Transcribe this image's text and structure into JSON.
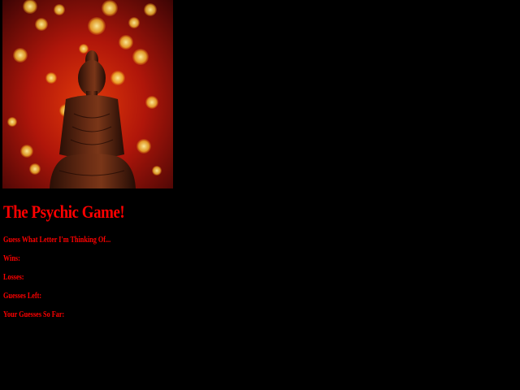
{
  "hero": {
    "icon": "buddha-bokeh-image"
  },
  "game": {
    "title": "The Psychic Game!",
    "prompt": "Guess What Letter I'm Thinking Of...",
    "wins_label": "Wins:",
    "wins_value": "",
    "losses_label": "Losses:",
    "losses_value": "",
    "guesses_left_label": "Guesses Left:",
    "guesses_left_value": "",
    "guesses_so_far_label": "Your Guesses So Far:",
    "guesses_so_far_value": ""
  },
  "colors": {
    "background": "#000000",
    "text": "#ff0000"
  }
}
